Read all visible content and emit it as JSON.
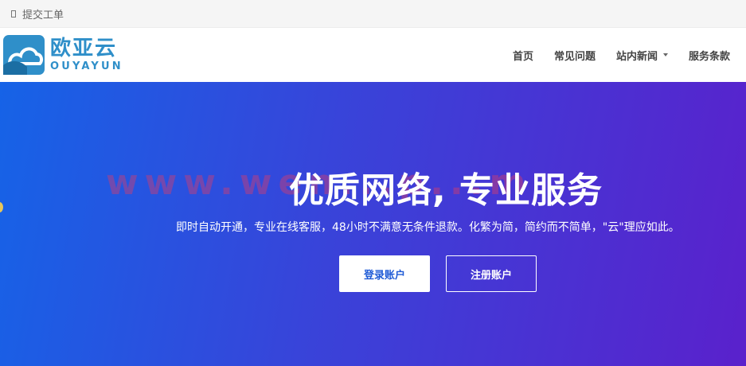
{
  "topbar": {
    "ticket_label": "提交工单"
  },
  "logo": {
    "name_cn": "欧亚云",
    "name_en": "OUYAYUN"
  },
  "nav": {
    "items": [
      {
        "label": "首页"
      },
      {
        "label": "常见问题"
      },
      {
        "label": "站内新闻",
        "dropdown": true
      },
      {
        "label": "服务条款"
      }
    ]
  },
  "hero": {
    "watermark": "www.wen...p...m",
    "title": "优质网络, 专业服务",
    "subtitle": "即时自动开通，专业在线客服，48小时不满意无条件退款。化繁为简，简约而不简单，\"云\"理应如此。",
    "login_button": "登录账户",
    "register_button": "注册账户"
  },
  "colors": {
    "brand": "#2f8fc9",
    "hero_start": "#1663e7",
    "hero_end": "#5a21cc"
  }
}
